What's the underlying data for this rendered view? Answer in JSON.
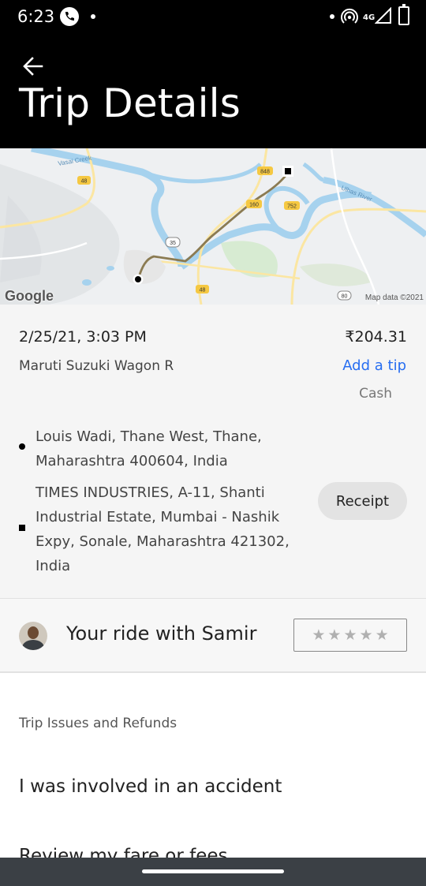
{
  "status_bar": {
    "time": "6:23",
    "network": "4G",
    "icons": [
      "phone-call-icon",
      "hotspot-icon",
      "signal-icon",
      "battery-icon"
    ]
  },
  "header": {
    "title": "Trip Details",
    "back_icon": "arrow-left-icon",
    "background": "#000000"
  },
  "map": {
    "brand": "Google",
    "attribution": "Map data ©2021",
    "labels": {
      "river_1": "Vasai Creek",
      "river_2": "Ulhas River",
      "shield_48a": "48",
      "shield_848": "848",
      "shield_160": "160",
      "shield_752": "752",
      "shield_35": "35",
      "shield_48b": "48",
      "shield_80": "80"
    }
  },
  "trip": {
    "datetime": "2/25/21, 3:03 PM",
    "fare": "₹204.31",
    "vehicle": "Maruti Suzuki Wagon R",
    "add_tip_label": "Add a tip",
    "payment_method": "Cash",
    "pickup_address": "Louis Wadi, Thane West, Thane, Maharashtra 400604, India",
    "dropoff_address": "TIMES INDUSTRIES, A-11, Shanti Industrial Estate, Mumbai - Nashik Expy, Sonale, Maharashtra 421302, India",
    "receipt_label": "Receipt"
  },
  "driver": {
    "ride_text": "Your ride with Samir",
    "rating_stars": 5,
    "rating_value": 0
  },
  "issues": {
    "heading": "Trip Issues and Refunds",
    "items": [
      "I was involved in an accident",
      "Review my fare or fees"
    ]
  },
  "colors": {
    "accent": "#276ef1",
    "route": "#8b7b52"
  }
}
